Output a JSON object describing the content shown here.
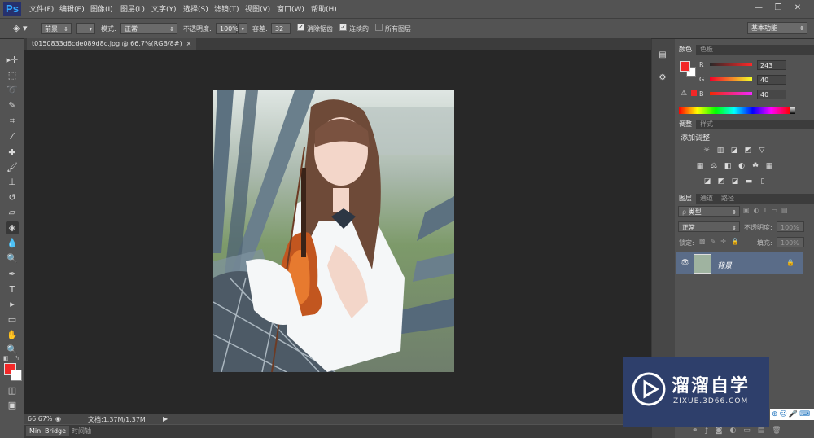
{
  "app": {
    "logo": "Ps"
  },
  "menu": [
    "文件(F)",
    "编辑(E)",
    "图像(I)",
    "图层(L)",
    "文字(Y)",
    "选择(S)",
    "滤镜(T)",
    "视图(V)",
    "窗口(W)",
    "帮助(H)"
  ],
  "window_controls": {
    "minimize": "—",
    "restore": "❐",
    "close": "✕"
  },
  "options_bar": {
    "fill_source": "前景",
    "mode_label": "模式:",
    "mode_value": "正常",
    "opacity_label": "不透明度:",
    "opacity_value": "100%",
    "tolerance_label": "容差:",
    "tolerance_value": "32",
    "antialias_label": "消除锯齿",
    "antialias_checked": true,
    "contiguous_label": "连续的",
    "contiguous_checked": true,
    "all_layers_label": "所有图层",
    "all_layers_checked": false,
    "workspace": "基本功能"
  },
  "document": {
    "tab_title": "t0150833d6cde089d8c.jpg @ 66.7%(RGB/8#)",
    "tab_close": "×",
    "zoom": "66.67%",
    "doc_size": "文档:1.37M/1.37M"
  },
  "bottom_tabs": [
    "Mini Bridge",
    "时间轴"
  ],
  "tools": [
    {
      "name": "move-tool-icon",
      "glyph": "▸✛"
    },
    {
      "name": "marquee-tool-icon",
      "glyph": "⬚"
    },
    {
      "name": "lasso-tool-icon",
      "glyph": "➰"
    },
    {
      "name": "quick-select-tool-icon",
      "glyph": "✎"
    },
    {
      "name": "crop-tool-icon",
      "glyph": "⌗"
    },
    {
      "name": "eyedropper-tool-icon",
      "glyph": "⁄"
    },
    {
      "name": "healing-brush-tool-icon",
      "glyph": "✚"
    },
    {
      "name": "brush-tool-icon",
      "glyph": "🖌"
    },
    {
      "name": "clone-stamp-tool-icon",
      "glyph": "⊥"
    },
    {
      "name": "history-brush-tool-icon",
      "glyph": "↺"
    },
    {
      "name": "eraser-tool-icon",
      "glyph": "▱"
    },
    {
      "name": "paint-bucket-tool-icon",
      "glyph": "◈"
    },
    {
      "name": "blur-tool-icon",
      "glyph": "💧"
    },
    {
      "name": "dodge-tool-icon",
      "glyph": "🔍"
    },
    {
      "name": "pen-tool-icon",
      "glyph": "✒"
    },
    {
      "name": "type-tool-icon",
      "glyph": "T"
    },
    {
      "name": "path-select-tool-icon",
      "glyph": "▸"
    },
    {
      "name": "shape-tool-icon",
      "glyph": "▭"
    },
    {
      "name": "hand-tool-icon",
      "glyph": "✋"
    },
    {
      "name": "zoom-tool-icon",
      "glyph": "🔍"
    }
  ],
  "color_panel": {
    "tabs": [
      "颜色",
      "色板"
    ],
    "channels": [
      {
        "label": "R",
        "value": "243"
      },
      {
        "label": "G",
        "value": "40"
      },
      {
        "label": "B",
        "value": "40"
      }
    ],
    "foreground": "#f32828",
    "background": "#ffffff"
  },
  "adjustments_panel": {
    "tabs": [
      "调整",
      "样式"
    ],
    "title": "添加调整"
  },
  "layers_panel": {
    "tabs": [
      "图层",
      "通道",
      "路径"
    ],
    "filter_kind": "类型",
    "blend_mode": "正常",
    "opacity_label": "不透明度:",
    "opacity_value": "100%",
    "lock_label": "锁定:",
    "fill_label": "填充:",
    "fill_value": "100%",
    "layers": [
      {
        "name": "背景",
        "visible": true,
        "locked": true
      }
    ]
  },
  "watermark": {
    "brand": "溜溜自学",
    "url": "ZIXUE.3D66.COM"
  }
}
